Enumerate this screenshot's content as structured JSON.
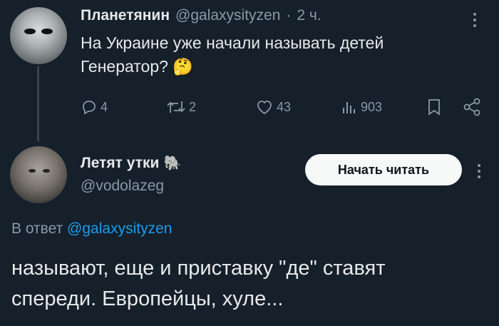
{
  "tweet1": {
    "display_name": "Планетянин",
    "handle": "@galaxysityzen",
    "separator": "·",
    "time": "2 ч.",
    "text_line1": "На Украине уже начали называть детей",
    "text_line2": "Генератор?",
    "emoji": "🤔",
    "actions": {
      "replies": "4",
      "retweets": "2",
      "likes": "43",
      "views": "903"
    }
  },
  "tweet2": {
    "display_name": "Летят утки",
    "name_emoji": "🐘",
    "handle": "@vodolazeg",
    "follow_button": "Начать читать",
    "reply_prefix": "В ответ",
    "reply_handle": "@galaxysityzen",
    "text_line1": "называют, еще и приставку \"де\" ставят",
    "text_line2": "спереди. Европейцы, хуле..."
  },
  "colors": {
    "background": "#15202b",
    "text": "#e7e9ea",
    "secondary": "#8b98a5",
    "link": "#1d9bf0",
    "button_bg": "#f7f9f9"
  }
}
